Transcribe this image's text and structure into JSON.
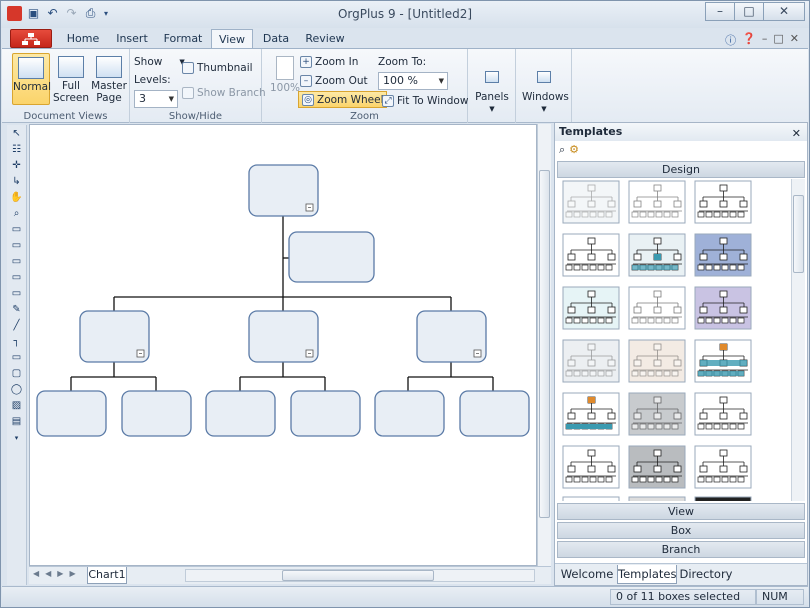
{
  "window": {
    "title": "OrgPlus 9 - [Untitled2]"
  },
  "tabs": [
    "Home",
    "Insert",
    "Format",
    "View",
    "Data",
    "Review"
  ],
  "active_tab": "View",
  "ribbon": {
    "document_views": {
      "label": "Document Views",
      "normal": "Normal",
      "full_screen": "Full Screen",
      "master_page": "Master Page"
    },
    "show_hide": {
      "label": "Show/Hide",
      "show": "Show",
      "levels_label": "Levels:",
      "levels_value": "3",
      "thumbnail": "Thumbnail",
      "show_branch": "Show Branch"
    },
    "zoom": {
      "label": "Zoom",
      "percent_btn": "100%",
      "zoom_in": "Zoom In",
      "zoom_out": "Zoom Out",
      "zoom_wheel": "Zoom Wheel",
      "zoom_to_label": "Zoom To:",
      "zoom_to_value": "100 %",
      "fit_to_window": "Fit To Window"
    },
    "panels": "Panels",
    "windows": "Windows"
  },
  "sheet_tab": "Chart1",
  "templates_panel": {
    "title": "Templates",
    "design": "Design",
    "view": "View",
    "box": "Box",
    "branch": "Branch",
    "tabs": [
      "Welcome",
      "Templates",
      "Directory"
    ],
    "active_tab": "Templates"
  },
  "status": {
    "selection": "0 of 11 boxes selected",
    "num": "NUM"
  },
  "colors": {
    "box_fill": "#e8eef5",
    "box_stroke": "#5a7aa6",
    "file_button": "#d6372a"
  }
}
